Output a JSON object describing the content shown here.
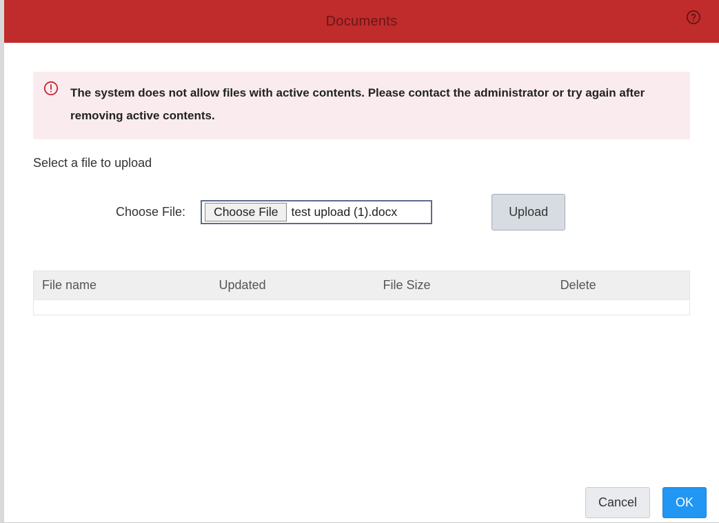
{
  "header": {
    "title": "Documents"
  },
  "alert": {
    "message": "The system does not allow files with active contents. Please contact the administrator or try again after removing active contents."
  },
  "select_label": "Select a file to upload",
  "choose_label": "Choose File:",
  "choose_button": "Choose File",
  "selected_file": "test upload (1).docx",
  "upload_button": "Upload",
  "table": {
    "headers": {
      "file_name": "File name",
      "updated": "Updated",
      "file_size": "File Size",
      "delete": "Delete"
    }
  },
  "footer": {
    "cancel": "Cancel",
    "ok": "OK"
  }
}
